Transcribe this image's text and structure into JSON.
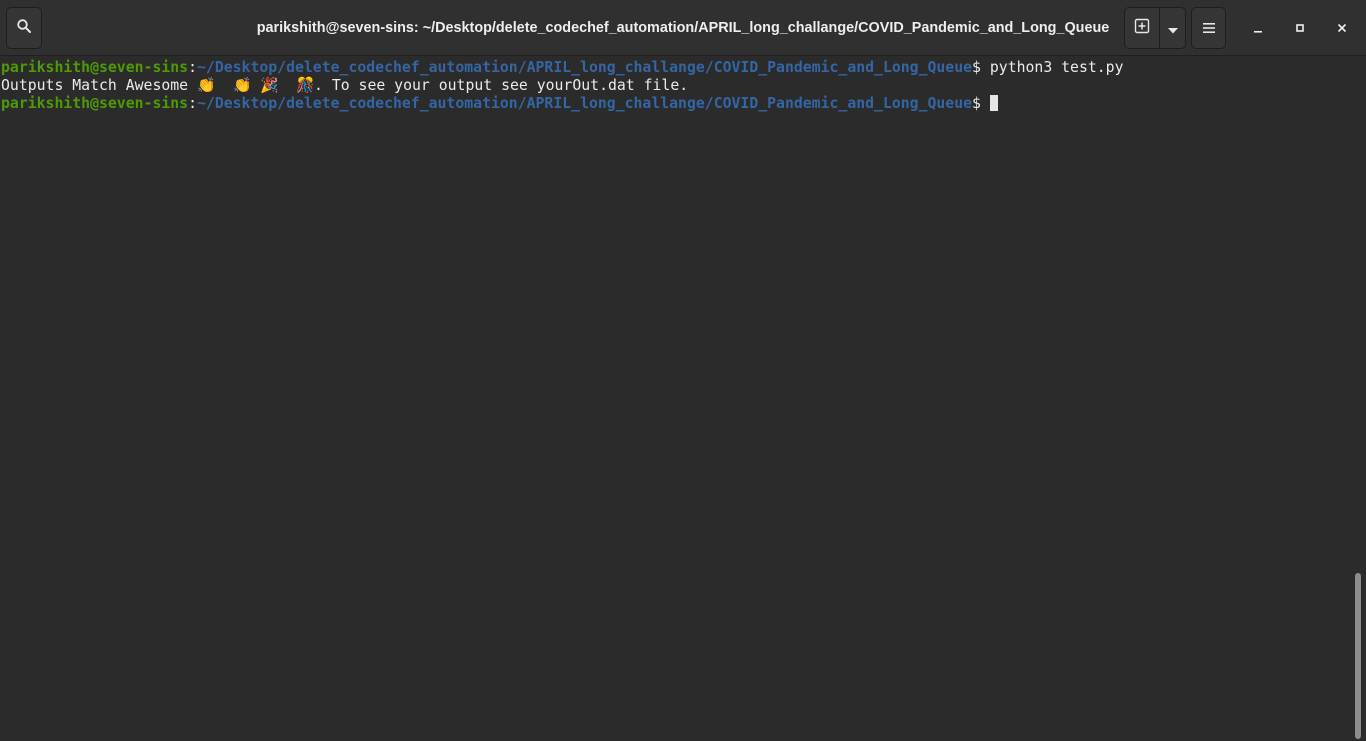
{
  "window": {
    "title": "parikshith@seven-sins: ~/Desktop/delete_codechef_automation/APRIL_long_challange/COVID_Pandemic_and_Long_Queue"
  },
  "headerbar": {
    "search_icon": "search-icon",
    "new_tab_icon": "new-tab-icon",
    "dropdown_icon": "chevron-down-icon",
    "menu_icon": "hamburger-menu-icon",
    "minimize_icon": "minimize-icon",
    "maximize_icon": "maximize-icon",
    "close_icon": "close-icon"
  },
  "colors": {
    "background": "#2b2b2b",
    "headerbar": "#303030",
    "prompt_user": "#4e9a06",
    "prompt_path": "#3465a4",
    "text": "#ebebeb"
  },
  "terminal": {
    "lines": [
      {
        "user": "parikshith@seven-sins",
        "sep": ":",
        "path": "~/Desktop/delete_codechef_automation/APRIL_long_challange/COVID_Pandemic_and_Long_Queue",
        "symbol": "$ ",
        "command": "python3 test.py"
      },
      {
        "text_before": "Outputs Match Awesome ",
        "emojis": [
          "👏",
          "👏",
          "🎉",
          "🎊"
        ],
        "text_after": ". To see your output see yourOut.dat file."
      },
      {
        "user": "parikshith@seven-sins",
        "sep": ":",
        "path": "~/Desktop/delete_codechef_automation/APRIL_long_challange/COVID_Pandemic_and_Long_Queue",
        "symbol": "$ ",
        "command": ""
      }
    ]
  }
}
